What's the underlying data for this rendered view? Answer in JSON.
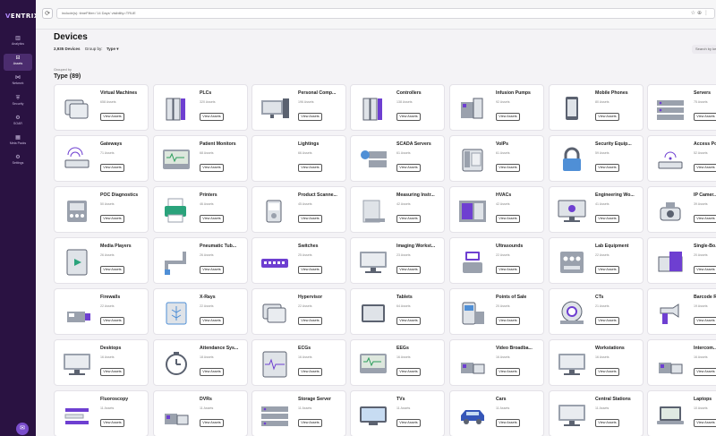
{
  "sidebar": {
    "logo_prefix": "V",
    "logo_rest": "ENTRIX",
    "items": [
      {
        "label": "Analytics",
        "icon": "analytics-icon",
        "glyph": "▥"
      },
      {
        "label": "Assets",
        "icon": "assets-icon",
        "glyph": "⊟",
        "active": true
      },
      {
        "label": "Network",
        "icon": "network-icon",
        "glyph": "⋈"
      },
      {
        "label": "Security",
        "icon": "security-icon",
        "glyph": "⛨"
      },
      {
        "label": "SOAR",
        "icon": "soar-icon",
        "glyph": "⚙"
      },
      {
        "label": "Meta Packs",
        "icon": "meta-packs-icon",
        "glyph": "▦"
      },
      {
        "label": "Settings",
        "icon": "settings-icon",
        "glyph": "⚙"
      }
    ]
  },
  "browser": {
    "url": "include(s): timeFilter='14 Days' visibility=TRUE"
  },
  "header": {
    "title": "Devices",
    "device_count": "2,935 Devices",
    "group_by_label": "Group by:",
    "group_by_value": "Type",
    "search_placeholder": "Search by keyword"
  },
  "group": {
    "grouped_by_label": "Grouped by",
    "type_heading": "Type (89)"
  },
  "accent_color": "#6e3fd1",
  "view_label": "View Assets",
  "cards": [
    {
      "name": "Virtual Machines",
      "count": "658 Assets",
      "icon": "virtual-machine-icon"
    },
    {
      "name": "PLCs",
      "count": "320 Assets",
      "icon": "plc-icon"
    },
    {
      "name": "Personal Comp...",
      "count": "196 Assets",
      "icon": "personal-computer-icon"
    },
    {
      "name": "Controllers",
      "count": "138 Assets",
      "icon": "controller-icon"
    },
    {
      "name": "Infusion Pumps",
      "count": "92 Assets",
      "icon": "infusion-pump-icon"
    },
    {
      "name": "Mobile Phones",
      "count": "80 Assets",
      "icon": "mobile-phone-icon"
    },
    {
      "name": "Servers",
      "count": "75 Assets",
      "icon": "server-icon"
    },
    {
      "name": "Gateways",
      "count": "71 Assets",
      "icon": "gateway-icon"
    },
    {
      "name": "Patient Monitors",
      "count": "68 Assets",
      "icon": "patient-monitor-icon"
    },
    {
      "name": "Lightings",
      "count": "66 Assets",
      "icon": "lighting-icon"
    },
    {
      "name": "SCADA Servers",
      "count": "61 Assets",
      "icon": "scada-server-icon"
    },
    {
      "name": "VoIPs",
      "count": "61 Assets",
      "icon": "voip-icon"
    },
    {
      "name": "Security Equip...",
      "count": "59 Assets",
      "icon": "security-equipment-icon"
    },
    {
      "name": "Access Po...",
      "count": "52 Assets",
      "icon": "access-point-icon"
    },
    {
      "name": "POC Diagnostics",
      "count": "50 Assets",
      "icon": "poc-diagnostics-icon"
    },
    {
      "name": "Printers",
      "count": "46 Assets",
      "icon": "printer-icon"
    },
    {
      "name": "Product Scanne...",
      "count": "45 Assets",
      "icon": "product-scanner-icon"
    },
    {
      "name": "Measuring Instr...",
      "count": "42 Assets",
      "icon": "measuring-instrument-icon"
    },
    {
      "name": "HVACs",
      "count": "42 Assets",
      "icon": "hvac-icon"
    },
    {
      "name": "Engineering Wo...",
      "count": "41 Assets",
      "icon": "engineering-workstation-icon"
    },
    {
      "name": "IP Camer...",
      "count": "39 Assets",
      "icon": "ip-camera-icon"
    },
    {
      "name": "Media Players",
      "count": "26 Assets",
      "icon": "media-player-icon"
    },
    {
      "name": "Pneumatic Tub...",
      "count": "26 Assets",
      "icon": "pneumatic-tube-icon"
    },
    {
      "name": "Switches",
      "count": "25 Assets",
      "icon": "switch-icon"
    },
    {
      "name": "Imaging Workst...",
      "count": "23 Assets",
      "icon": "imaging-workstation-icon"
    },
    {
      "name": "Ultrasounds",
      "count": "22 Assets",
      "icon": "ultrasound-icon"
    },
    {
      "name": "Lab Equipment",
      "count": "22 Assets",
      "icon": "lab-equipment-icon"
    },
    {
      "name": "Single-Bo...",
      "count": "20 Assets",
      "icon": "single-board-computer-icon"
    },
    {
      "name": "Firewalls",
      "count": "22 Assets",
      "icon": "firewall-icon"
    },
    {
      "name": "X-Rays",
      "count": "22 Assets",
      "icon": "x-ray-icon"
    },
    {
      "name": "Hypervisor",
      "count": "22 Assets",
      "icon": "hypervisor-icon"
    },
    {
      "name": "Tablets",
      "count": "64 Assets",
      "icon": "tablet-icon"
    },
    {
      "name": "Points of Sale",
      "count": "20 Assets",
      "icon": "point-of-sale-icon"
    },
    {
      "name": "CTs",
      "count": "21 Assets",
      "icon": "ct-scanner-icon"
    },
    {
      "name": "Barcode R...",
      "count": "19 Assets",
      "icon": "barcode-reader-icon"
    },
    {
      "name": "Desktops",
      "count": "16 Assets",
      "icon": "desktop-icon"
    },
    {
      "name": "Attendance Sys...",
      "count": "18 Assets",
      "icon": "attendance-system-icon"
    },
    {
      "name": "ECGs",
      "count": "16 Assets",
      "icon": "ecg-icon"
    },
    {
      "name": "EEGs",
      "count": "16 Assets",
      "icon": "eeg-icon"
    },
    {
      "name": "Video Broadba...",
      "count": "16 Assets",
      "icon": "video-broadband-icon"
    },
    {
      "name": "Workstations",
      "count": "16 Assets",
      "icon": "workstation-icon"
    },
    {
      "name": "Intercom...",
      "count": "16 Assets",
      "icon": "intercom-icon"
    },
    {
      "name": "Fluoroscopy",
      "count": "11 Assets",
      "icon": "fluoroscopy-icon"
    },
    {
      "name": "DVRs",
      "count": "11 Assets",
      "icon": "dvr-icon"
    },
    {
      "name": "Storage Server",
      "count": "11 Assets",
      "icon": "storage-server-icon"
    },
    {
      "name": "TVs",
      "count": "11 Assets",
      "icon": "tv-icon"
    },
    {
      "name": "Cars",
      "count": "11 Assets",
      "icon": "car-icon"
    },
    {
      "name": "Central Stations",
      "count": "11 Assets",
      "icon": "central-station-icon"
    },
    {
      "name": "Laptops",
      "count": "10 Assets",
      "icon": "laptop-icon"
    }
  ]
}
